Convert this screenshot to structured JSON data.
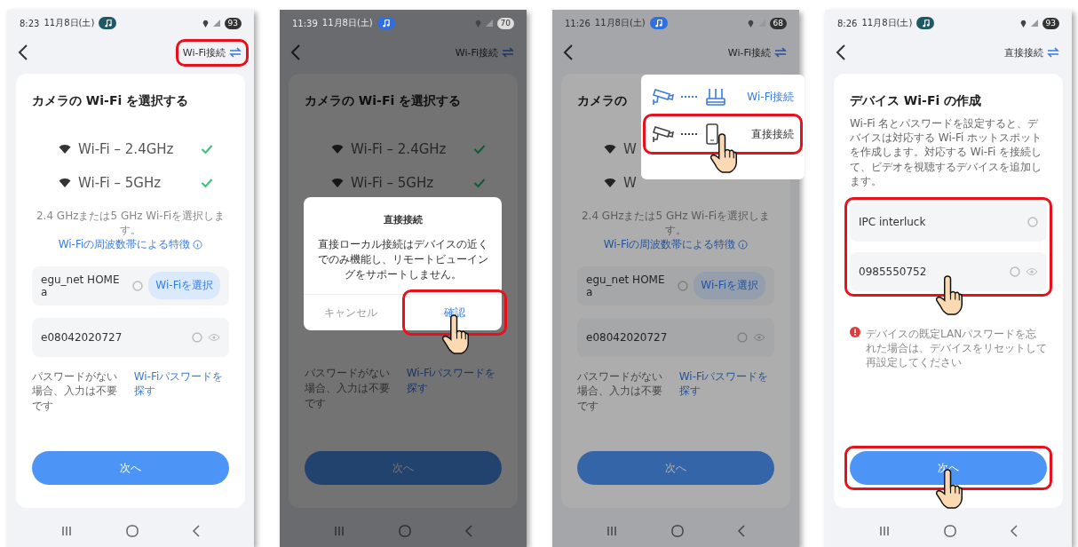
{
  "panels": [
    {
      "kind": "select_wifi",
      "status": {
        "time": "8:23",
        "date": "11月8日(土)",
        "battery": "93",
        "badge": {
          "color": "#1d5a66"
        }
      },
      "mode_button": {
        "label": "Wi-Fi接続",
        "annotated": true
      },
      "title": "カメラの Wi-Fi を選択する",
      "bands": [
        {
          "label": "Wi-Fi – 2.4GHz",
          "checked": true
        },
        {
          "label": "Wi-Fi – 5GHz",
          "checked": true
        }
      ],
      "note": {
        "text": "2.4 GHzまたは5 GHz Wi-Fiを選択します。",
        "link": "Wi-Fiの周波数帯による特徴"
      },
      "ssid_field": {
        "value": "egu_net HOME a",
        "button": "Wi-Fiを選択"
      },
      "password_field": {
        "value": "e08042020727"
      },
      "hint": {
        "text": "パスワードがない場合、入力は不要です",
        "link": "Wi-Fiパスワードを探す"
      },
      "next_button": {
        "label": "次へ"
      }
    },
    {
      "kind": "select_wifi",
      "status": {
        "time": "11:39",
        "date": "11月8日(土)",
        "battery": "70",
        "badge": {
          "color": "#2f6fe0"
        }
      },
      "mode_button": {
        "label": "Wi-Fi接続"
      },
      "title": "カメラの Wi-Fi を選択する",
      "bands": [
        {
          "label": "Wi-Fi – 2.4GHz",
          "checked": true
        },
        {
          "label": "Wi-Fi – 5GHz",
          "checked": true
        }
      ],
      "hint": {
        "text": "パスワードがない場合、入力は不要です",
        "link": "Wi-Fiパスワードを探す"
      },
      "next_button": {
        "label": "次へ"
      },
      "overlay": {
        "kind": "dialog",
        "title": "直接接続",
        "message": "直接ローカル接続はデバイスの近くでのみ機能し、リモートビューイングをサポートしません。",
        "buttons": [
          {
            "label": "キャンセル",
            "primary": false
          },
          {
            "label": "確認",
            "primary": true,
            "annotated": true,
            "tapped": true
          }
        ]
      }
    },
    {
      "kind": "select_wifi",
      "status": {
        "time": "11:26",
        "date": "11月8日(土)",
        "battery": "68",
        "badge": {
          "color": "#2f6fe0"
        }
      },
      "mode_button": {
        "label": "Wi-Fi接続"
      },
      "title": "カメラの",
      "bands": [
        {
          "label": "W"
        },
        {
          "label": "W"
        }
      ],
      "note": {
        "text": "2.4 GHzまたは5 GHz Wi-Fiを選択します。",
        "link": "Wi-Fiの周波数帯による特徴"
      },
      "ssid_field": {
        "value": "egu_net HOME a",
        "button": "Wi-Fiを選択"
      },
      "password_field": {
        "value": "e08042020727"
      },
      "hint": {
        "text": "パスワードがない場合、入力は不要です",
        "link": "Wi-Fiパスワードを探す"
      },
      "next_button": {
        "label": "次へ"
      },
      "overlay": {
        "kind": "menu",
        "items": [
          {
            "kind": "router",
            "label": "Wi-Fi接続",
            "selected": true
          },
          {
            "kind": "phone",
            "label": "直接接続",
            "selected": false,
            "annotated": true,
            "tapped": true
          }
        ]
      }
    },
    {
      "kind": "create_wifi",
      "status": {
        "time": "8:26",
        "date": "11月8日(土)",
        "battery": "93",
        "badge": {
          "color": "#1d5a66"
        }
      },
      "mode_button": {
        "label": "直接接続"
      },
      "title": "デバイス Wi-Fi の作成",
      "description": "Wi-Fi 名とパスワードを設定すると、デバイスは対応する Wi-Fi ホットスポットを作成します。対応する Wi-Fi を接続して、ビデオを視聴するデバイスを追加します。",
      "fields": {
        "annotated": true,
        "tapped": true,
        "items": [
          {
            "kind": "name",
            "value": "IPC interluck"
          },
          {
            "kind": "password",
            "value": "0985550752"
          }
        ]
      },
      "warning": "デバイスの既定LANパスワードを忘れた場合は、デバイスをリセットして再設定してください",
      "next_button": {
        "label": "次へ",
        "annotated": true,
        "tapped": true
      }
    }
  ]
}
